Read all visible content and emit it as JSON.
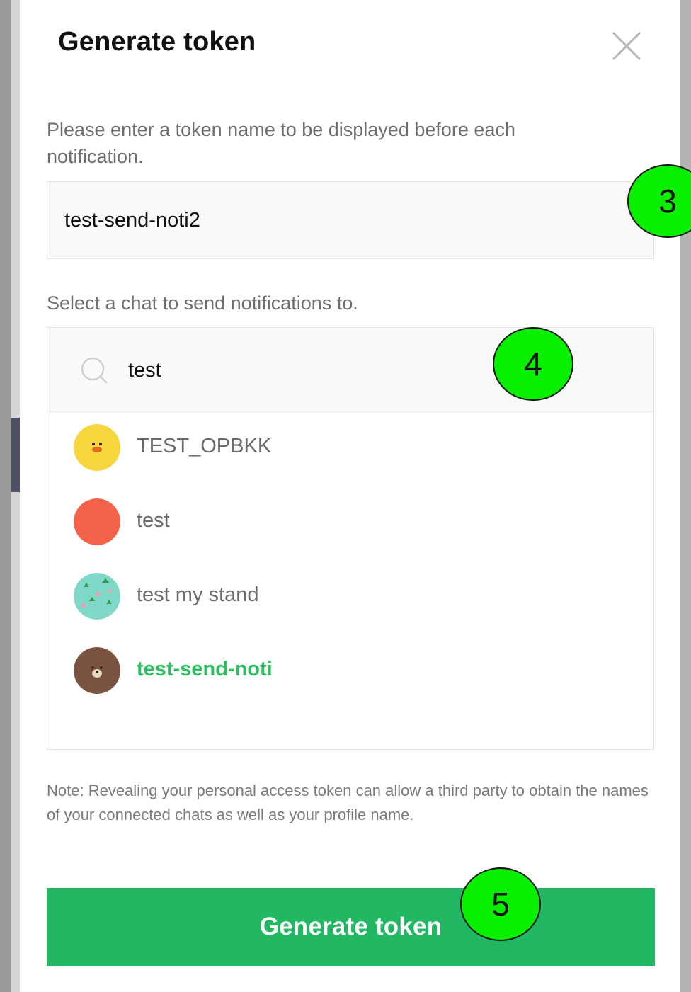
{
  "dialog": {
    "title": "Generate token",
    "close_icon": "close-icon"
  },
  "token_name": {
    "label": "Please enter a token name to be displayed before each notification.",
    "value": "test-send-noti2"
  },
  "chat_select": {
    "label": "Select a chat to send notifications to.",
    "search_value": "test",
    "search_icon": "search-icon",
    "items": [
      {
        "name": "TEST_OPBKK",
        "avatar": "chick-avatar",
        "selected": false
      },
      {
        "name": "test",
        "avatar": "red-circle-avatar",
        "selected": false
      },
      {
        "name": "test my stand",
        "avatar": "cactus-pattern-avatar",
        "selected": false
      },
      {
        "name": "test-send-noti",
        "avatar": "bear-avatar",
        "selected": true
      }
    ]
  },
  "note": "Note: Revealing your personal access token can allow a third party to obtain the names of your connected chats as well as your profile name.",
  "generate_button_label": "Generate token",
  "step_badges": [
    "3",
    "4",
    "5"
  ],
  "colors": {
    "accent_green": "#22b863",
    "selected_text": "#2dbe60",
    "badge_fill": "#08f000"
  }
}
